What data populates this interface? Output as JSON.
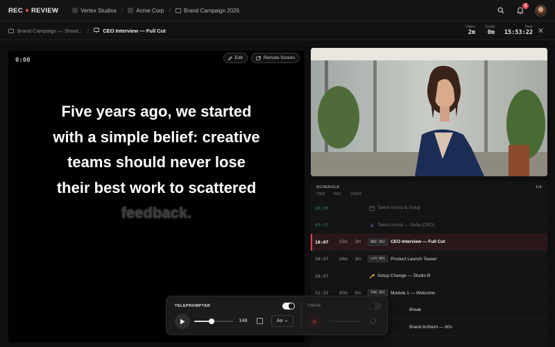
{
  "app": {
    "logo_left": "REC",
    "logo_right": "REVIEW"
  },
  "breadcrumbs": [
    "Vertex Studios",
    "Acme Corp",
    "Brand Campaign 2026"
  ],
  "notifications": {
    "count": "3"
  },
  "subbar": {
    "parent": "Brand Campaign — Shoot...",
    "current": "CEO Interview — Full Cut",
    "stats": [
      {
        "label": "Video",
        "value": "2m"
      },
      {
        "label": "Script",
        "value": "0m"
      },
      {
        "label": "Time",
        "value": "15:53:22"
      }
    ]
  },
  "prompter": {
    "timer": "0:00",
    "edit_label": "Edit",
    "remote_label": "Remote Screen",
    "script_lines": [
      "Five years ago, we started",
      "with a simple belief: creative",
      "teams should never lose",
      "their best work to scattered"
    ],
    "script_fade": "feedback."
  },
  "schedule": {
    "title": "SCHEDULE",
    "progress": "1/4",
    "columns": [
      "TIME",
      "REC",
      "VIDEO"
    ],
    "rows": [
      {
        "time": "08:00",
        "rec": "",
        "video": "",
        "code": "",
        "icon": "calendar-icon",
        "title": "Talent Arrival & Setup",
        "state": "done"
      },
      {
        "time": "09:37",
        "rec": "",
        "video": "",
        "code": "",
        "icon": "makeup-icon",
        "title": "Talent Arrival — Sofia (CEO)",
        "state": "done"
      },
      {
        "time": "10:07",
        "rec": "15m",
        "video": "2m",
        "code": "BRD_002",
        "icon": "",
        "title": "CEO Interview — Full Cut",
        "state": "current"
      },
      {
        "time": "10:37",
        "rec": "24m",
        "video": "3m",
        "code": "LCH_001",
        "icon": "",
        "title": "Product Launch Teaser",
        "state": "future"
      },
      {
        "time": "10:57",
        "rec": "",
        "video": "",
        "code": "",
        "icon": "wrench-icon",
        "title": "Setup Change — Studio B",
        "state": "future"
      },
      {
        "time": "11:22",
        "rec": "30m",
        "video": "5m",
        "code": "TRN_001",
        "icon": "",
        "title": "Module 1 — Welcome",
        "state": "future"
      },
      {
        "time": "",
        "rec": "",
        "video": "",
        "code": "",
        "icon": "",
        "title": "Break",
        "state": "future"
      },
      {
        "time": "",
        "rec": "",
        "video": "",
        "code": "",
        "icon": "",
        "title": "Brand Anthem — 60s",
        "state": "future"
      }
    ]
  },
  "controls": {
    "teleprompter_label": "TELEPROMPTER",
    "teleprompter_on": true,
    "speed": "140",
    "speed_level": 0.45,
    "font_label": "Aa",
    "timer_label": "TIMER",
    "timer_on": false
  },
  "colors": {
    "accent": "#e5484d",
    "done": "#4caf7a"
  }
}
